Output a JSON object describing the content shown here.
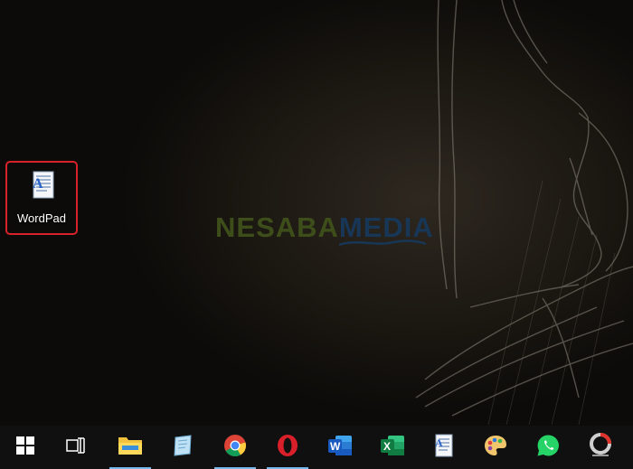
{
  "desktop": {
    "watermark": {
      "part1": "NESABA",
      "part2": "MEDIA"
    },
    "icons": [
      {
        "label": "WordPad",
        "icon": "wordpad-icon",
        "highlighted": true
      }
    ]
  },
  "taskbar": {
    "items": [
      {
        "name": "start",
        "icon": "windows-logo-icon",
        "running": false
      },
      {
        "name": "task-view",
        "icon": "task-view-icon",
        "running": false
      },
      {
        "name": "file-explorer",
        "icon": "folder-icon",
        "running": true
      },
      {
        "name": "notepad-app",
        "icon": "notepad-icon",
        "running": false
      },
      {
        "name": "chrome",
        "icon": "chrome-icon",
        "running": true
      },
      {
        "name": "opera",
        "icon": "opera-icon",
        "running": true
      },
      {
        "name": "word",
        "icon": "word-icon",
        "running": false
      },
      {
        "name": "excel",
        "icon": "excel-icon",
        "running": false
      },
      {
        "name": "wordpad",
        "icon": "wordpad-icon",
        "running": false
      },
      {
        "name": "paint",
        "icon": "paint-palette-icon",
        "running": false
      },
      {
        "name": "whatsapp",
        "icon": "whatsapp-icon",
        "running": false
      },
      {
        "name": "photoscape",
        "icon": "photoscape-icon",
        "running": false
      }
    ]
  },
  "colors": {
    "highlight_border": "#d8222a",
    "running_indicator": "#76b9ed",
    "taskbar_bg": "#101010"
  }
}
